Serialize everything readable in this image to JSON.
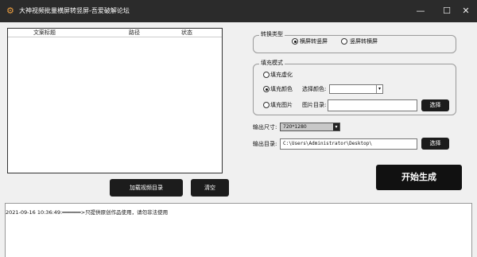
{
  "window": {
    "title": "大神视频批量横屏转竖屏-吾爱破解论坛",
    "app_icon": "⚙",
    "minimize": "—",
    "maximize": "☐",
    "close": "✕"
  },
  "table": {
    "columns": [
      "文案标题",
      "路径",
      "状态"
    ]
  },
  "buttons": {
    "load_video_dir": "加载视频目录",
    "clear": "清空",
    "choose_image_dir": "选择",
    "choose_output_dir": "选择",
    "start": "开始生成"
  },
  "convert_group": {
    "legend": "转换类型",
    "options": [
      "横屏转竖屏",
      "竖屏转横屏"
    ],
    "selected": 0
  },
  "fill_group": {
    "legend": "填充模式",
    "blur_label": "填充虚化",
    "color_label": "填充颜色",
    "image_label": "填充图片",
    "choose_color_label": "选择颜色:",
    "image_dir_label": "图片目录:",
    "color_value": "",
    "image_dir_value": "",
    "selected": "color"
  },
  "output": {
    "size_label": "输出尺寸:",
    "size_value": "720*1280",
    "dir_label": "输出目录:",
    "dir_value": "C:\\Users\\Administrator\\Desktop\\"
  },
  "log": {
    "lines": [
      "2021-09-16 10:36:49:━━━━━━>只提供原创作品使用，请勿非法使用"
    ]
  }
}
